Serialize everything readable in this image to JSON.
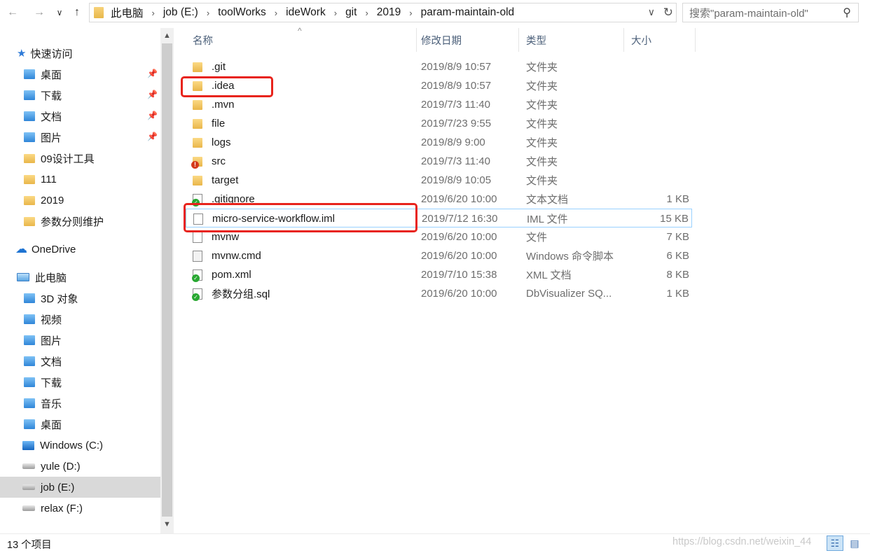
{
  "address": {
    "back_icon": "←",
    "forward_icon": "→",
    "recent_icon": "∨",
    "up_icon": "↑",
    "breadcrumbs": [
      "此电脑",
      "job (E:)",
      "toolWorks",
      "ideWork",
      "git",
      "2019",
      "param-maintain-old"
    ],
    "separator": "›",
    "dropdown_icon": "∨",
    "refresh_icon": "↻"
  },
  "search": {
    "placeholder": "搜索\"param-maintain-old\"",
    "icon": "⚲"
  },
  "sidebar": {
    "quick_access": "快速访问",
    "quick_items": [
      {
        "label": "桌面",
        "pinned": true
      },
      {
        "label": "下载",
        "pinned": true
      },
      {
        "label": "文档",
        "pinned": true
      },
      {
        "label": "图片",
        "pinned": true
      },
      {
        "label": "09设计工具",
        "pinned": false
      },
      {
        "label": "111",
        "pinned": false
      },
      {
        "label": "2019",
        "pinned": false
      },
      {
        "label": "参数分则维护",
        "pinned": false
      }
    ],
    "onedrive": "OneDrive",
    "this_pc": "此电脑",
    "pc_items": [
      "3D 对象",
      "视频",
      "图片",
      "文档",
      "下载",
      "音乐",
      "桌面"
    ],
    "drives": [
      "Windows (C:)",
      "yule (D:)",
      "job (E:)",
      "relax (F:)"
    ],
    "selected": "job (E:)",
    "pin_icon": "📌"
  },
  "columns": {
    "name": "名称",
    "date": "修改日期",
    "type": "类型",
    "size": "大小"
  },
  "files": [
    {
      "name": ".git",
      "date": "2019/8/9 10:57",
      "type": "文件夹",
      "size": "",
      "icon": "folder"
    },
    {
      "name": ".idea",
      "date": "2019/8/9 10:57",
      "type": "文件夹",
      "size": "",
      "icon": "folder"
    },
    {
      "name": ".mvn",
      "date": "2019/7/3 11:40",
      "type": "文件夹",
      "size": "",
      "icon": "folder"
    },
    {
      "name": "file",
      "date": "2019/7/23 9:55",
      "type": "文件夹",
      "size": "",
      "icon": "folder"
    },
    {
      "name": "logs",
      "date": "2019/8/9 9:00",
      "type": "文件夹",
      "size": "",
      "icon": "folder"
    },
    {
      "name": "src",
      "date": "2019/7/3 11:40",
      "type": "文件夹",
      "size": "",
      "icon": "folder-error"
    },
    {
      "name": "target",
      "date": "2019/8/9 10:05",
      "type": "文件夹",
      "size": "",
      "icon": "folder"
    },
    {
      "name": ".gitignore",
      "date": "2019/6/20 10:00",
      "type": "文本文档",
      "size": "1 KB",
      "icon": "doc-ok"
    },
    {
      "name": "micro-service-workflow.iml",
      "date": "2019/7/12 16:30",
      "type": "IML 文件",
      "size": "15 KB",
      "icon": "doc"
    },
    {
      "name": "mvnw",
      "date": "2019/6/20 10:00",
      "type": "文件",
      "size": "7 KB",
      "icon": "doc"
    },
    {
      "name": "mvnw.cmd",
      "date": "2019/6/20 10:00",
      "type": "Windows 命令脚本",
      "size": "6 KB",
      "icon": "cmd"
    },
    {
      "name": "pom.xml",
      "date": "2019/7/10 15:38",
      "type": "XML 文档",
      "size": "8 KB",
      "icon": "doc-ok"
    },
    {
      "name": "参数分组.sql",
      "date": "2019/6/20 10:00",
      "type": "DbVisualizer SQ...",
      "size": "1 KB",
      "icon": "doc-ok"
    }
  ],
  "hovered_file": "micro-service-workflow.iml",
  "highlighted_files": [
    ".idea",
    "micro-service-workflow.iml"
  ],
  "highlight_color": "#e8241c",
  "status": {
    "count": "13 个项目"
  },
  "watermark": "https://blog.csdn.net/weixin_44",
  "view_icons": {
    "details": "☷",
    "tiles": "▤"
  }
}
